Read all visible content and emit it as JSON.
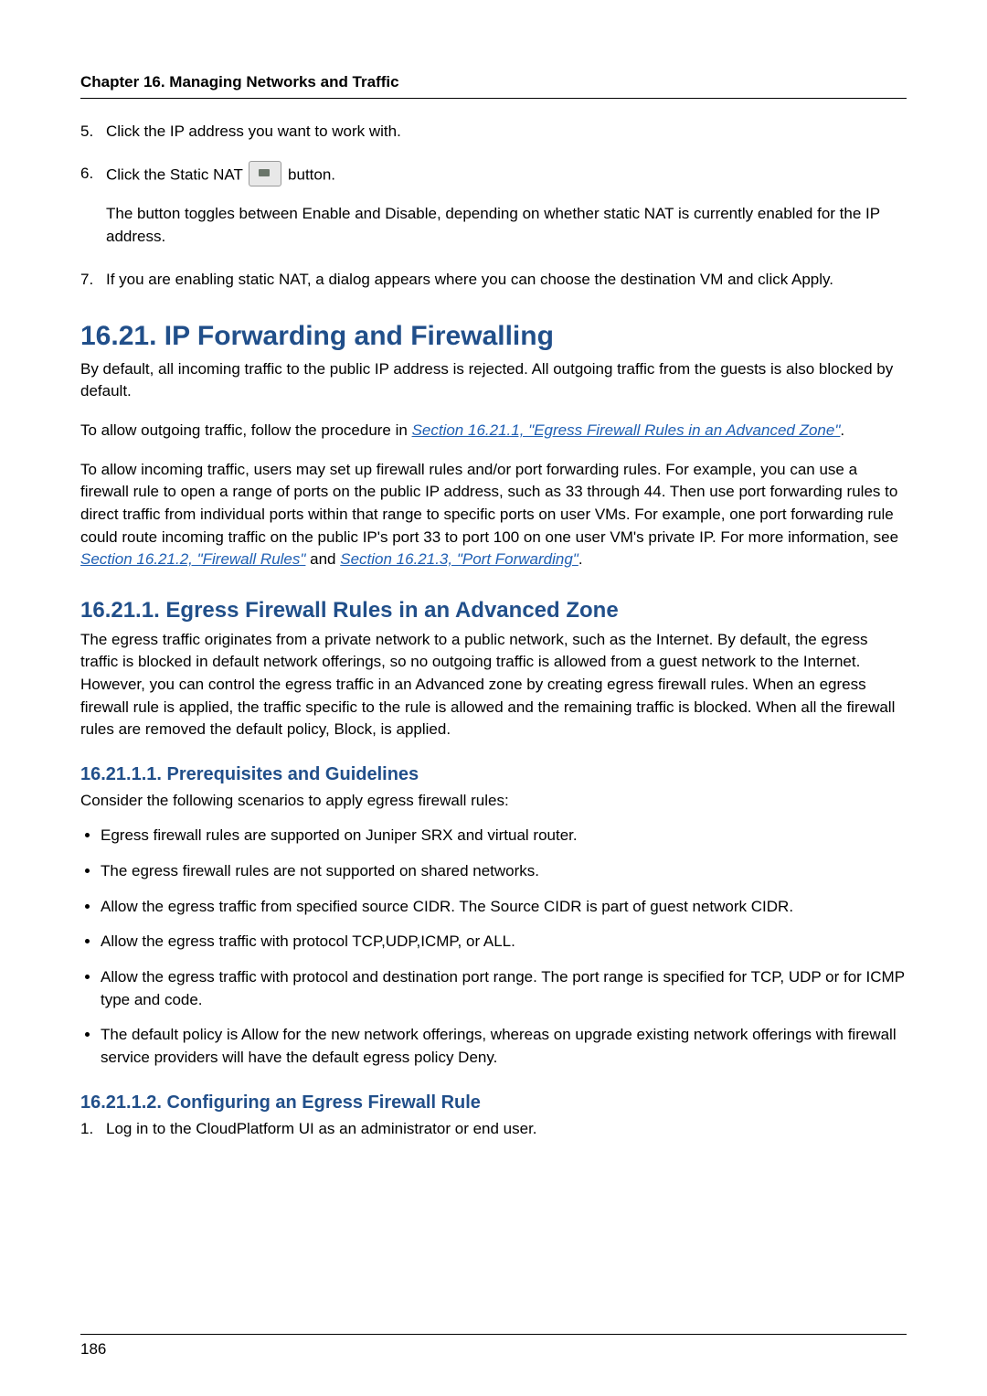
{
  "chapter_heading": "Chapter 16. Managing Networks and Traffic",
  "steps_a": {
    "item5": {
      "num": "5.",
      "text": "Click the IP address you want to work with."
    },
    "item6": {
      "num": "6.",
      "line_pre": "Click the Static NAT ",
      "line_post": " button.",
      "para": "The button toggles between Enable and Disable, depending on whether static NAT is currently enabled for the IP address."
    },
    "item7": {
      "num": "7.",
      "text": "If you are enabling static NAT, a dialog appears where you can choose the destination VM and click Apply."
    }
  },
  "sec_16_21": {
    "title": "16.21. IP Forwarding and Firewalling",
    "p1": "By default, all incoming traffic to the public IP address is rejected. All outgoing traffic from the guests is also blocked by default.",
    "p2_pre": "To allow outgoing traffic, follow the procedure in ",
    "p2_link": "Section 16.21.1, \"Egress Firewall Rules in an Advanced Zone\"",
    "p2_post": ".",
    "p3_pre": "To allow incoming traffic, users may set up firewall rules and/or port forwarding rules. For example, you can use a firewall rule to open a range of ports on the public IP address, such as 33 through 44. Then use port forwarding rules to direct traffic from individual ports within that range to specific ports on user VMs. For example, one port forwarding rule could route incoming traffic on the public IP's port 33 to port 100 on one user VM's private IP. For more information, see ",
    "p3_link1": "Section 16.21.2, \"Firewall Rules\"",
    "p3_mid": " and ",
    "p3_link2": "Section 16.21.3, \"Port Forwarding\"",
    "p3_post": "."
  },
  "sec_16_21_1": {
    "title": "16.21.1. Egress Firewall Rules in an Advanced Zone",
    "p1": "The egress traffic originates from a private network to a public network, such as the Internet. By default, the egress traffic is blocked in default network offerings, so no outgoing traffic is allowed from a guest network to the Internet. However, you can control the egress traffic in an Advanced zone by creating egress firewall rules. When an egress firewall rule is applied, the traffic specific to the rule is allowed and the remaining traffic is blocked. When all the firewall rules are removed the default policy, Block, is applied."
  },
  "sec_16_21_1_1": {
    "title": "16.21.1.1. Prerequisites and Guidelines",
    "intro": "Consider the following scenarios to apply egress firewall rules:",
    "bullets": [
      "Egress firewall rules are supported on Juniper SRX and virtual router.",
      "The egress firewall rules are not supported on shared networks.",
      "Allow the egress traffic from specified source CIDR. The Source CIDR is part of guest network CIDR.",
      "Allow the egress traffic with protocol TCP,UDP,ICMP, or ALL.",
      "Allow the egress traffic with protocol and destination port range. The port range is specified for TCP, UDP or for ICMP type and code.",
      "The default policy is Allow for the new network offerings, whereas on upgrade existing network offerings with firewall service providers will have the default egress policy Deny."
    ]
  },
  "sec_16_21_1_2": {
    "title": "16.21.1.2. Configuring an Egress Firewall Rule",
    "step1": {
      "num": "1.",
      "text": "Log in to the CloudPlatform UI as an administrator or end user."
    }
  },
  "page_number": "186"
}
